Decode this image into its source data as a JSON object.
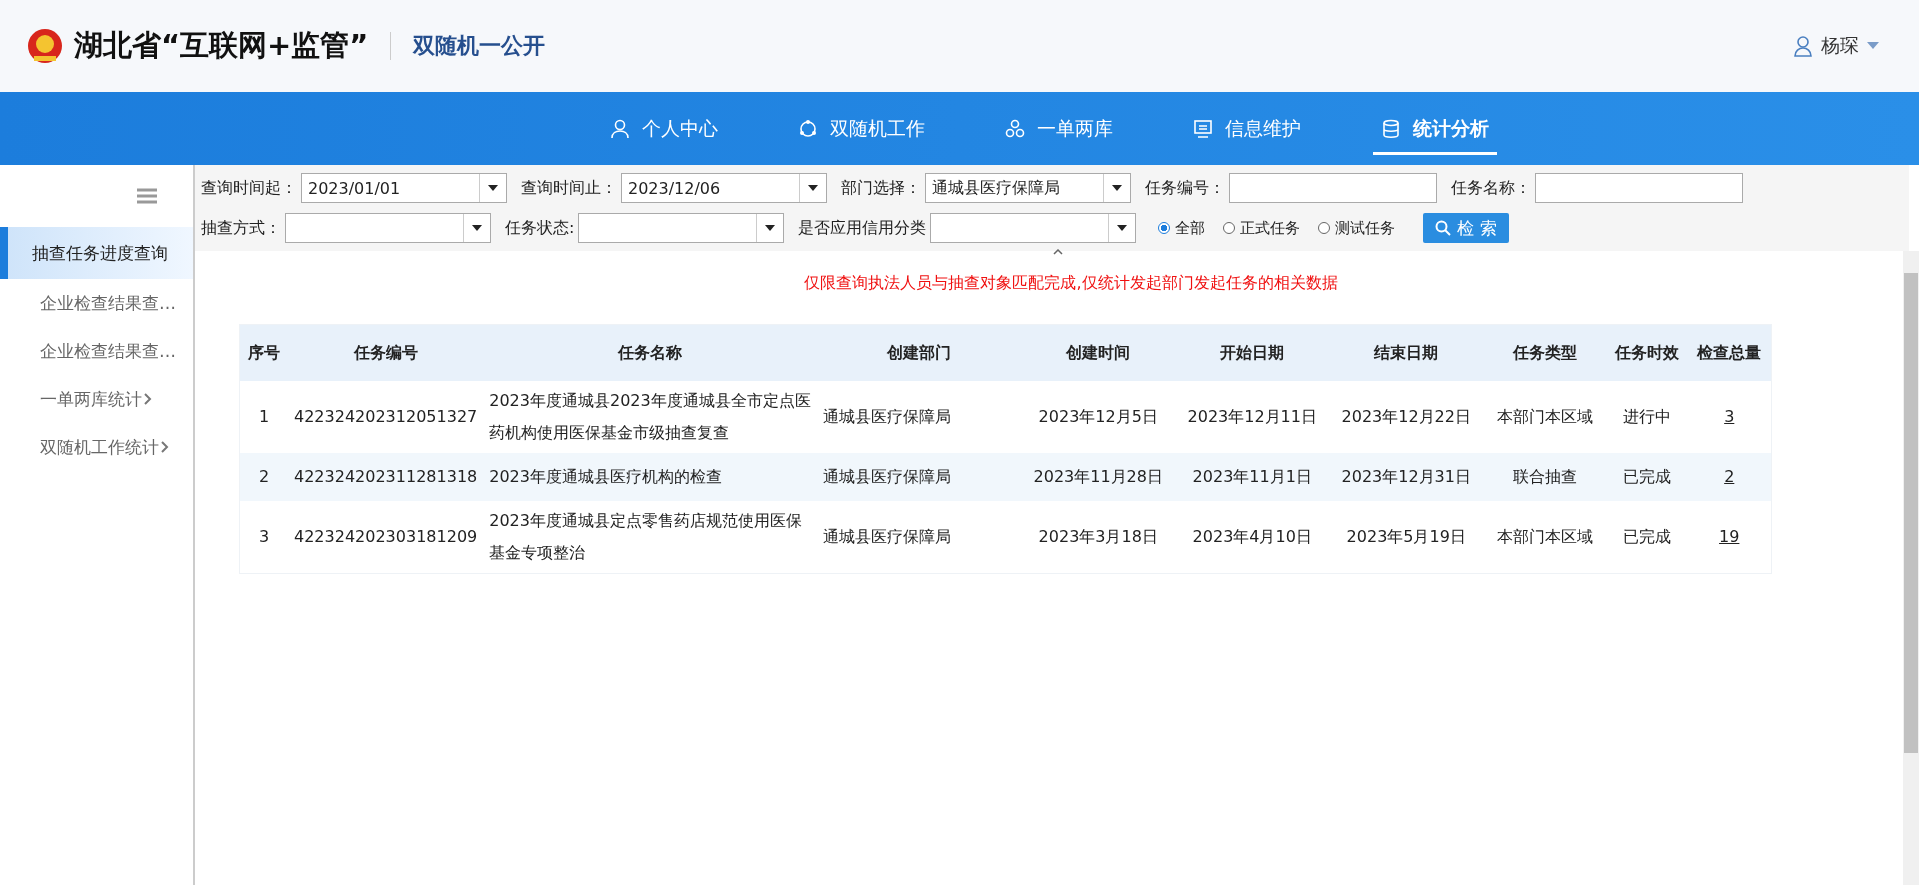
{
  "header": {
    "title": "湖北省“互联网+监管”",
    "subtitle": "双随机一公开",
    "user": "杨琛"
  },
  "nav": [
    {
      "label": "个人中心",
      "selected": false
    },
    {
      "label": "双随机工作",
      "selected": false
    },
    {
      "label": "一单两库",
      "selected": false
    },
    {
      "label": "信息维护",
      "selected": false
    },
    {
      "label": "统计分析",
      "selected": true
    }
  ],
  "sidebar": {
    "items": [
      {
        "label": "抽查任务进度查询",
        "selected": true,
        "has_arrow": false
      },
      {
        "label": "企业检查结果查…",
        "selected": false,
        "has_arrow": false
      },
      {
        "label": "企业检查结果查…",
        "selected": false,
        "has_arrow": false
      },
      {
        "label": "一单两库统计",
        "selected": false,
        "has_arrow": true
      },
      {
        "label": "双随机工作统计",
        "selected": false,
        "has_arrow": true
      }
    ]
  },
  "filters": [
    {
      "label": "查询时间起：",
      "kind": "select",
      "value": "2023/01/01"
    },
    {
      "label": "查询时间止：",
      "kind": "select",
      "value": "2023/12/06"
    },
    {
      "label": "部门选择：",
      "kind": "select",
      "value": "通城县医疗保障局"
    },
    {
      "label": "任务编号：",
      "kind": "input"
    },
    {
      "label": "任务名称：",
      "kind": "input"
    },
    {
      "label": "抽查方式：",
      "kind": "select"
    },
    {
      "label": "任务状态:",
      "kind": "select"
    },
    {
      "label": "是否应用信用分类",
      "kind": "select"
    }
  ],
  "radios": [
    {
      "label": "全部",
      "selected": true
    },
    {
      "label": "正式任务",
      "selected": false
    },
    {
      "label": "测试任务",
      "selected": false
    }
  ],
  "search_button": "检 索",
  "notice": "仅限查询执法人员与抽查对象匹配完成,仅统计发起部门发起任务的相关数据",
  "table": {
    "columns": [
      "序号",
      "任务编号",
      "任务名称",
      "创建部门",
      "创建时间",
      "开始日期",
      "结束日期",
      "任务类型",
      "任务时效",
      "检查总量"
    ],
    "rows": [
      [
        "1",
        "422324202312051327",
        "2023年度通城县2023年度通城县全市定点医药机构使用医保基金市级抽查复查",
        "通城县医疗保障局",
        "2023年12月5日",
        "2023年12月11日",
        "2023年12月22日",
        "本部门本区域",
        "进行中",
        "3"
      ],
      [
        "2",
        "422324202311281318",
        "2023年度通城县医疗机构的检查",
        "通城县医疗保障局",
        "2023年11月28日",
        "2023年11月1日",
        "2023年12月31日",
        "联合抽查",
        "已完成",
        "2"
      ],
      [
        "3",
        "422324202303181209",
        "2023年度通城县定点零售药店规范使用医保基金专项整治",
        "通城县医疗保障局",
        "2023年3月18日",
        "2023年4月10日",
        "2023年5月19日",
        "本部门本区域",
        "已完成",
        "19"
      ]
    ]
  }
}
